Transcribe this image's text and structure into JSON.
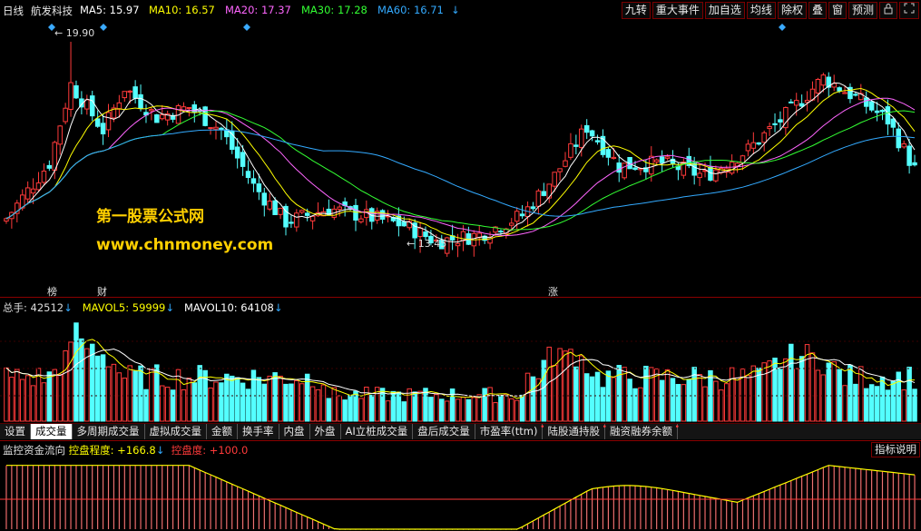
{
  "header": {
    "period": "日线",
    "stock_name": "航发科技",
    "ma5": "MA5: 15.97",
    "ma10": "MA10: 16.57",
    "ma20": "MA20: 17.37",
    "ma30": "MA30: 17.28",
    "ma60": "MA60: 16.71",
    "arrow": "↓",
    "buttons": [
      "九转",
      "重大事件",
      "加自选",
      "均线",
      "除权",
      "叠",
      "窗",
      "预测"
    ],
    "lock_icon": "lock-icon",
    "fullscreen_icon": "fullscreen-icon"
  },
  "price_chart": {
    "high_label": "19.90",
    "low_label": "13.45",
    "watermark_line1": "第一股票公式网",
    "watermark_line2": "www.chnmoney.com",
    "event_tags": [
      "榜",
      "财",
      "涨"
    ]
  },
  "volume_header": {
    "total": "总手: 42512",
    "mavol5": "MAVOL5: 59999",
    "mavol10": "MAVOL10: 64108",
    "arrow": "↓"
  },
  "tabs": [
    {
      "label": "设置",
      "active": false,
      "dot": false
    },
    {
      "label": "成交量",
      "active": true,
      "dot": false
    },
    {
      "label": "多周期成交量",
      "active": false,
      "dot": false
    },
    {
      "label": "虚拟成交量",
      "active": false,
      "dot": false
    },
    {
      "label": "金额",
      "active": false,
      "dot": false
    },
    {
      "label": "换手率",
      "active": false,
      "dot": false
    },
    {
      "label": "内盘",
      "active": false,
      "dot": false
    },
    {
      "label": "外盘",
      "active": false,
      "dot": false
    },
    {
      "label": "AI立桩成交量",
      "active": false,
      "dot": false
    },
    {
      "label": "盘后成交量",
      "active": false,
      "dot": false
    },
    {
      "label": "市盈率(ttm)",
      "active": false,
      "dot": true
    },
    {
      "label": "陆股通持股",
      "active": false,
      "dot": true
    },
    {
      "label": "融资融券余额",
      "active": false,
      "dot": true
    }
  ],
  "indicator_header": {
    "name": "监控资金流向",
    "degree": "控盘程度: +166.8",
    "arrow": "↓",
    "control": "控盘度: +100.0",
    "help": "指标说明"
  },
  "colors": {
    "up": "#ff3a3a",
    "down": "#54ffff",
    "ma5": "#ffffff",
    "ma10": "#ffff00",
    "ma20": "#ff66ff",
    "ma30": "#33ff33",
    "ma60": "#33aaff",
    "grid": "#8a0000"
  }
}
